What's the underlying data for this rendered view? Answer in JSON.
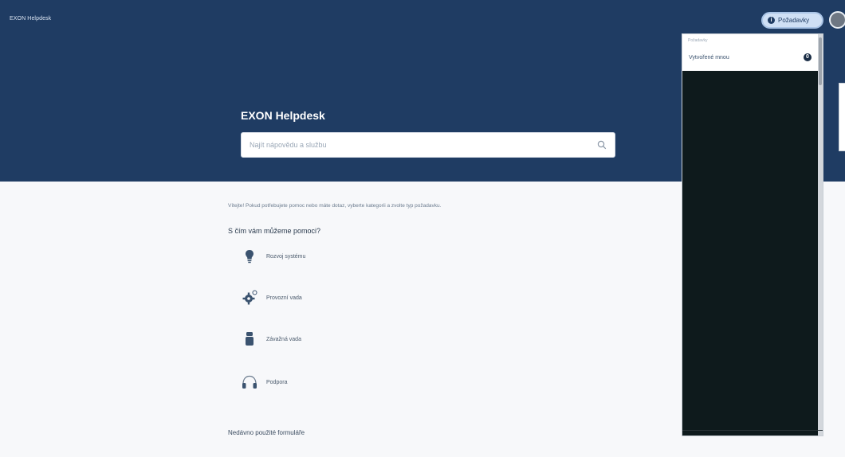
{
  "header": {
    "brand": "EXON Helpdesk",
    "requests_button": {
      "label": "Požadavky",
      "icon": "info-icon"
    },
    "avatar_icon": "user-avatar-icon"
  },
  "hero": {
    "title": "EXON Helpdesk",
    "search": {
      "placeholder": "Najít nápovědu a službu",
      "value": "",
      "icon": "search-icon"
    }
  },
  "dropdown": {
    "group_label": "Požadavky",
    "items": [
      {
        "label": "Vytvořené mnou",
        "badge": "0"
      }
    ]
  },
  "main": {
    "intro": "Vítejte! Pokud potřebujete pomoc nebo máte dotaz, vyberte kategorii a zvolte typ požadavku.",
    "section_title": "S čím vám můžeme pomoci?",
    "categories": [
      {
        "label": "Rozvoj systému",
        "icon": "lightbulb-icon"
      },
      {
        "label": "Provozní vada",
        "icon": "gear-icon"
      },
      {
        "label": "Závažná vada",
        "icon": "alert-icon"
      },
      {
        "label": "Podpora",
        "icon": "headset-icon"
      }
    ],
    "footer_link": "Nedávno použité formuláře"
  },
  "colors": {
    "header_bg": "#1f3c63",
    "page_bg": "#f7f8fa",
    "dropdown_bg": "#0e1a1c"
  }
}
